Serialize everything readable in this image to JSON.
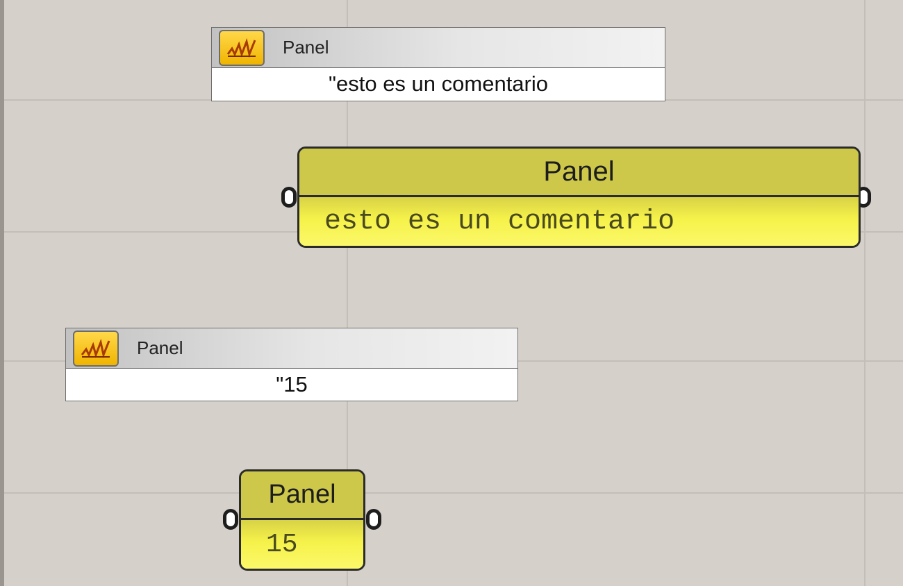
{
  "canvas": {
    "background": "#d5d0c9",
    "grid_color": "#c3beb7"
  },
  "tooltip_text": {
    "title": "Panel",
    "content": "\"esto es un comentario",
    "icon": "panel-icon"
  },
  "text_panel": {
    "title": "Panel",
    "content": "esto es un comentario"
  },
  "tooltip_number": {
    "title": "Panel",
    "content": "\"15",
    "icon": "panel-icon"
  },
  "number_panel": {
    "title": "Panel",
    "content": "15"
  },
  "colors": {
    "panel_fill": "#f6f24a",
    "panel_header": "#cdc84a",
    "icon_fill": "#f5c000"
  }
}
